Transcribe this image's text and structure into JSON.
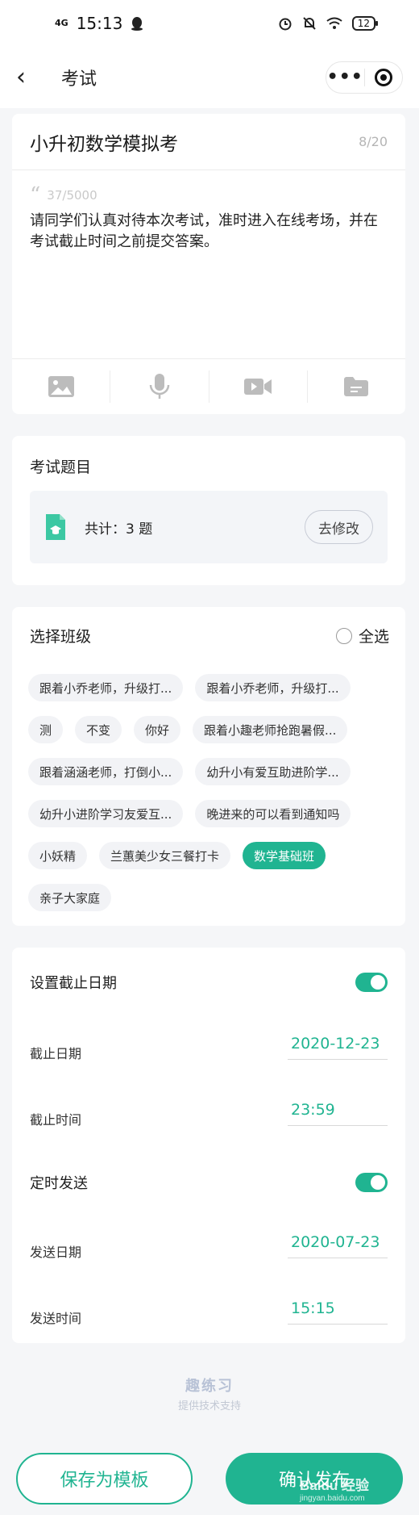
{
  "status_bar": {
    "signal": "4G",
    "time": "15:13",
    "battery": "12"
  },
  "nav": {
    "title": "考试"
  },
  "exam": {
    "title": "小升初数学模拟考",
    "title_count": "8/20",
    "desc_count": "37/5000",
    "description": "请同学们认真对待本次考试，准时进入在线考场，并在考试截止时间之前提交答案。"
  },
  "questions": {
    "section_title": "考试题目",
    "total": "共计：3 题",
    "edit_label": "去修改"
  },
  "classes": {
    "section_title": "选择班级",
    "select_all": "全选",
    "tags": [
      {
        "label": "跟着小乔老师，升级打...",
        "selected": false
      },
      {
        "label": "跟着小乔老师，升级打...",
        "selected": false
      },
      {
        "label": "测",
        "selected": false
      },
      {
        "label": "不变",
        "selected": false
      },
      {
        "label": "你好",
        "selected": false
      },
      {
        "label": "跟着小趣老师抢跑暑假...",
        "selected": false
      },
      {
        "label": "跟着涵涵老师，打倒小...",
        "selected": false
      },
      {
        "label": "幼升小有爱互助进阶学...",
        "selected": false
      },
      {
        "label": "幼升小进阶学习友爱互...",
        "selected": false
      },
      {
        "label": "晚进来的可以看到通知吗",
        "selected": false
      },
      {
        "label": "小妖精",
        "selected": false
      },
      {
        "label": "兰蕙美少女三餐打卡",
        "selected": false
      },
      {
        "label": "数学基础班",
        "selected": true
      },
      {
        "label": "亲子大家庭",
        "selected": false
      }
    ]
  },
  "settings": {
    "deadline_label": "设置截止日期",
    "deadline_enabled": true,
    "deadline_date_label": "截止日期",
    "deadline_date": "2020-12-23",
    "deadline_time_label": "截止时间",
    "deadline_time": "23:59",
    "schedule_label": "定时发送",
    "schedule_enabled": true,
    "send_date_label": "发送日期",
    "send_date": "2020-07-23",
    "send_time_label": "发送时间",
    "send_time": "15:15"
  },
  "brand": {
    "name": "趣练习",
    "sub": "提供技术支持"
  },
  "actions": {
    "save_template": "保存为模板",
    "publish": "确认发布"
  },
  "watermark": {
    "main": "Baidu 经验",
    "sub": "jingyan.baidu.com"
  },
  "colors": {
    "accent": "#20b491",
    "background": "#f5f6f8"
  }
}
